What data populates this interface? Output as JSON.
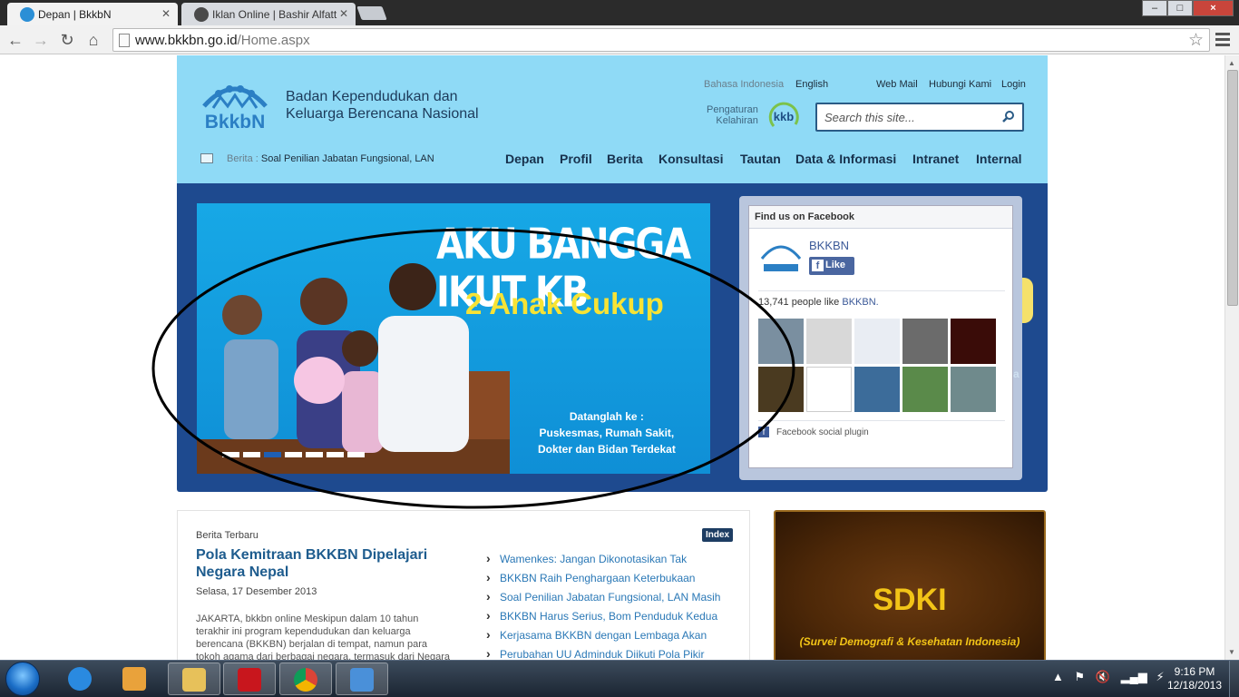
{
  "browser": {
    "tabs": [
      {
        "title": "Depan | BkkbN",
        "active": true
      },
      {
        "title": "Iklan Online | Bashir Alfatt",
        "active": false
      }
    ],
    "url": {
      "host": "www.bkkbn.go.id",
      "path": "/Home.aspx"
    },
    "window_buttons": {
      "minimize": "–",
      "maximize": "□",
      "close": "×"
    }
  },
  "site": {
    "logo_text": "BkkbN",
    "org_line1": "Badan Kependudukan dan",
    "org_line2": "Keluarga Berencana Nasional",
    "lang_indonesia": "Bahasa Indonesia",
    "lang_english": "English",
    "top_links": [
      "Web Mail",
      "Hubungi Kami",
      "Login"
    ],
    "pengaturan_line1": "Pengaturan",
    "pengaturan_line2": "Kelahiran",
    "kkb_text": "kkb",
    "search_placeholder": "Search this site...",
    "ticker_label": "Berita :",
    "ticker_text": "Soal Penilian Jabatan Fungsional, LAN",
    "nav": [
      "Depan",
      "Profil",
      "Berita",
      "Konsultasi",
      "Tautan",
      "Data & Informasi",
      "Intranet",
      "Internal"
    ]
  },
  "hero": {
    "title": "AKU BANGGA IKUT KB",
    "subtitle": "2 Anak Cukup",
    "small_line1": "Datanglah ke :",
    "small_line2": "Puskesmas, Rumah Sakit,",
    "small_line3": "Dokter dan Bidan Terdekat",
    "dots": 7,
    "active_dot": 3
  },
  "facebook": {
    "header": "Find us on Facebook",
    "page_name": "BKKBN",
    "like_label": "Like",
    "count_text": "13,741 people like ",
    "count_link": "BKKBN.",
    "plugin_label": "Facebook social plugin",
    "face_colors": [
      "#7a8fa0",
      "#d8d8d8",
      "#e9edf3",
      "#6b6b6b",
      "#3a0c08",
      "#4a3a20",
      "#ffffff",
      "#3c6c9a",
      "#5a8a4a",
      "#6f8a8c"
    ]
  },
  "news": {
    "label": "Berita Terbaru",
    "index_label": "Index",
    "title": "Pola Kemitraan BKKBN Dipelajari Negara Nepal",
    "date": "Selasa, 17 Desember 2013",
    "body": "JAKARTA, bkkbn online    Meskipun dalam 10 tahun terakhir ini program kependudukan dan keluarga berencana (BKKBN) berjalan di tempat, namun para tokoh agama dari berbagai negara, termasuk dari Negara Nepal",
    "list": [
      "Wamenkes: Jangan Dikonotasikan Tak",
      "BKKBN Raih Penghargaan Keterbukaan",
      "Soal Penilian Jabatan Fungsional, LAN Masih",
      "BKKBN Harus Serius, Bom Penduduk Kedua",
      "Kerjasama BKKBN dengan Lembaga Akan",
      "Perubahan UU Adminduk Diikuti Pola Pikir"
    ]
  },
  "banner": {
    "title": "SDKI",
    "subtitle": "(Survei Demografi & Kesehatan Indonesia)"
  },
  "taskbar": {
    "time": "9:16 PM",
    "date": "12/18/2013",
    "apps": [
      {
        "name": "internet-explorer",
        "color": "#2a8ae0",
        "open": false
      },
      {
        "name": "media-player",
        "color": "#e9a23b",
        "open": false
      },
      {
        "name": "file-explorer",
        "color": "#e7c15a",
        "open": true
      },
      {
        "name": "adobe-reader",
        "color": "#c8161d",
        "open": true
      },
      {
        "name": "chrome",
        "color": "#3c9d4a",
        "open": true
      },
      {
        "name": "paint",
        "color": "#4a90d9",
        "open": true
      }
    ]
  }
}
